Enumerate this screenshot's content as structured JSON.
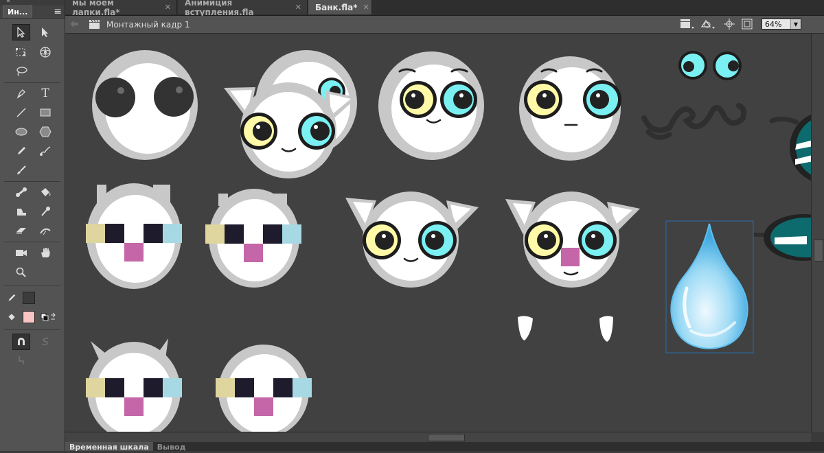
{
  "tools_panel": {
    "tab_label": "Ин...",
    "collapse_glyph": "«",
    "menu_glyph": "≡",
    "tools": [
      {
        "name": "selection-tool",
        "icon": "arrow-icon",
        "selected": true
      },
      {
        "name": "subselection-tool",
        "icon": "white-arrow-icon"
      },
      {
        "name": "free-transform-tool",
        "icon": "transform-icon"
      },
      {
        "name": "3d-rotation-tool",
        "icon": "rotate-3d-icon"
      },
      {
        "name": "lasso-tool",
        "icon": "lasso-icon"
      },
      {
        "name": "pen-tool",
        "icon": "pen-icon"
      },
      {
        "name": "text-tool",
        "icon": "text-icon",
        "glyph": "T"
      },
      {
        "name": "line-tool",
        "icon": "line-icon"
      },
      {
        "name": "rectangle-tool",
        "icon": "rectangle-icon"
      },
      {
        "name": "oval-tool",
        "icon": "oval-icon"
      },
      {
        "name": "polystar-tool",
        "icon": "hexagon-icon"
      },
      {
        "name": "pencil-tool",
        "icon": "pencil-icon"
      },
      {
        "name": "paint-brush-tool",
        "icon": "paint-brush-icon"
      },
      {
        "name": "brush-tool",
        "icon": "brush-icon"
      },
      {
        "name": "bone-tool",
        "icon": "bone-icon"
      },
      {
        "name": "paint-bucket-tool",
        "icon": "paint-bucket-icon"
      },
      {
        "name": "ink-bottle-tool",
        "icon": "ink-bottle-icon"
      },
      {
        "name": "eyedropper-tool",
        "icon": "eyedropper-icon"
      },
      {
        "name": "eraser-tool",
        "icon": "eraser-icon"
      },
      {
        "name": "width-tool",
        "icon": "width-icon"
      },
      {
        "name": "camera-tool",
        "icon": "camera-icon"
      },
      {
        "name": "hand-tool",
        "icon": "hand-icon"
      },
      {
        "name": "zoom-tool",
        "icon": "magnifier-icon"
      }
    ],
    "stroke_color": "#3c3c3c",
    "fill_color": "#f9c4c4",
    "snap_glyph": "S"
  },
  "doc_tabs": [
    {
      "label": "мы моем лапки.fla*",
      "active": false
    },
    {
      "label": "Анимиция вступления.fla",
      "active": false
    },
    {
      "label": "Банк.fla*",
      "active": true
    }
  ],
  "tab_close_glyph": "✕",
  "edit_bar": {
    "scene_label": "Монтажный кадр 1",
    "zoom_value": "64%"
  },
  "bottom_tabs": [
    {
      "label": "Временная шкала",
      "active": true
    },
    {
      "label": "Вывод",
      "active": false
    }
  ],
  "colors": {
    "stage": "#414141",
    "face_white": "#ffffff",
    "face_rim": "#c8c8c8",
    "eye_yellow": "#fffaa8",
    "eye_cyan": "#7af0f3",
    "block_tan": "#dfd59e",
    "block_blue": "#a6d9e3",
    "block_dark": "#1e1c2c",
    "nose_pink": "#c466a7",
    "teal": "#0d6b6e"
  }
}
